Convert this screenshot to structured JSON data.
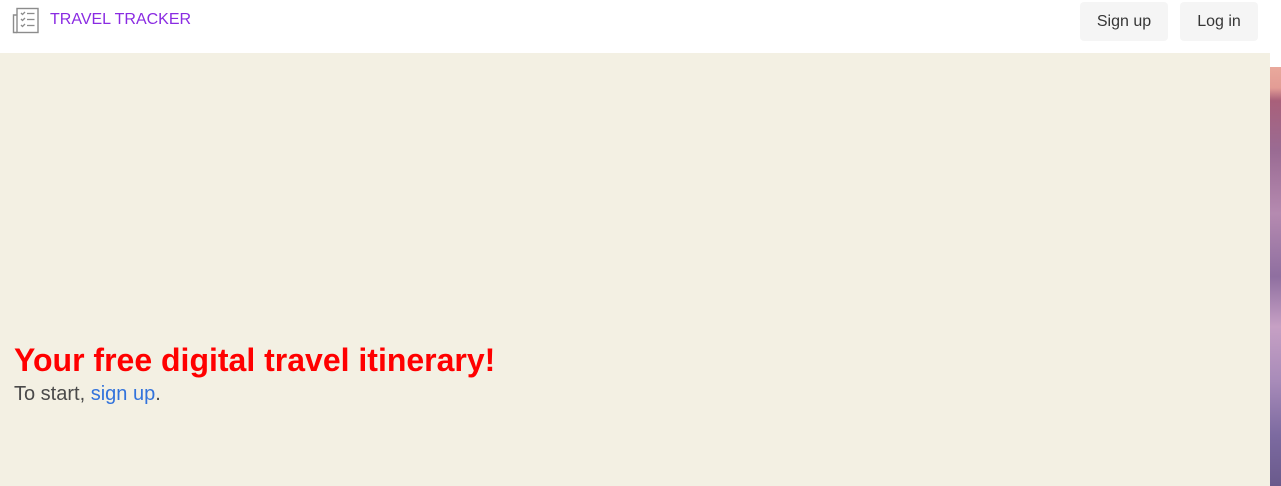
{
  "navbar": {
    "brand_label": "TRAVEL TRACKER",
    "brand_icon": "checklist-icon",
    "signup_label": "Sign up",
    "login_label": "Log in"
  },
  "hero": {
    "title": "Your free digital travel itinerary!",
    "subtitle_prefix": "To start, ",
    "subtitle_link": "sign up",
    "subtitle_suffix": "."
  },
  "colors": {
    "brand": "#8a2be2",
    "hero_background": "#f3f0e3",
    "title": "#ff0000",
    "link": "#3273dc",
    "button_background": "#f5f5f5"
  }
}
